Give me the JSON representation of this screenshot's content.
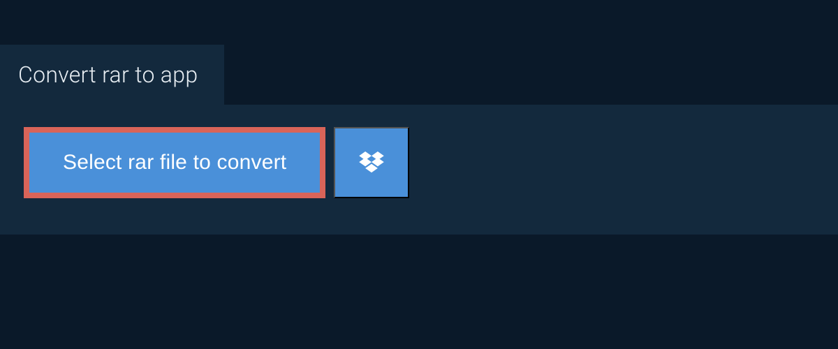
{
  "tab": {
    "title": "Convert rar to app"
  },
  "actions": {
    "select_file_label": "Select rar file to convert"
  },
  "colors": {
    "background": "#0a1929",
    "panel": "#13293d",
    "button": "#4a90d9",
    "highlight_border": "#d96459"
  }
}
